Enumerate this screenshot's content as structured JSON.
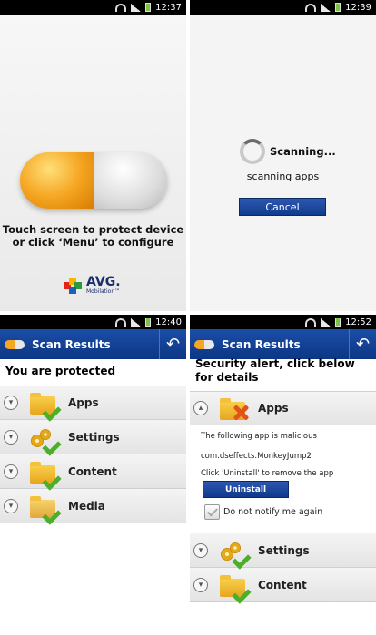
{
  "colors": {
    "header": "#1b4ea8",
    "button": "#1a47a0",
    "pill_orange": "#f5a623",
    "check_green": "#4caf2a"
  },
  "screens": [
    {
      "status_time": "12:37",
      "message_line1": "Touch screen to protect device",
      "message_line2": "or click ‘Menu’ to configure",
      "logo_brand": "AVG.",
      "logo_sub": "Mobilation™"
    },
    {
      "status_time": "12:39",
      "scanning_title": "Scanning...",
      "scanning_sub": "scanning apps",
      "cancel_label": "Cancel"
    },
    {
      "status_time": "12:40",
      "header_title": "Scan Results",
      "status_heading": "You are protected",
      "items": [
        {
          "label": "Apps",
          "icon": "folder-check-icon"
        },
        {
          "label": "Settings",
          "icon": "gears-check-icon"
        },
        {
          "label": "Content",
          "icon": "folder-check-icon"
        },
        {
          "label": "Media",
          "icon": "media-check-icon"
        }
      ]
    },
    {
      "status_time": "12:52",
      "header_title": "Scan Results",
      "alert_heading": "Security alert, click below for details",
      "expanded_label": "Apps",
      "malicious_text": "The following app is malicious",
      "package_name": "com.dseffects.MonkeyJump2",
      "instruction": "Click 'Uninstall' to remove the app",
      "uninstall_label": "Uninstall",
      "checkbox_label": "Do not notify me again",
      "items": [
        {
          "label": "Settings",
          "icon": "gears-check-icon"
        },
        {
          "label": "Content",
          "icon": "folder-check-icon"
        }
      ]
    }
  ]
}
